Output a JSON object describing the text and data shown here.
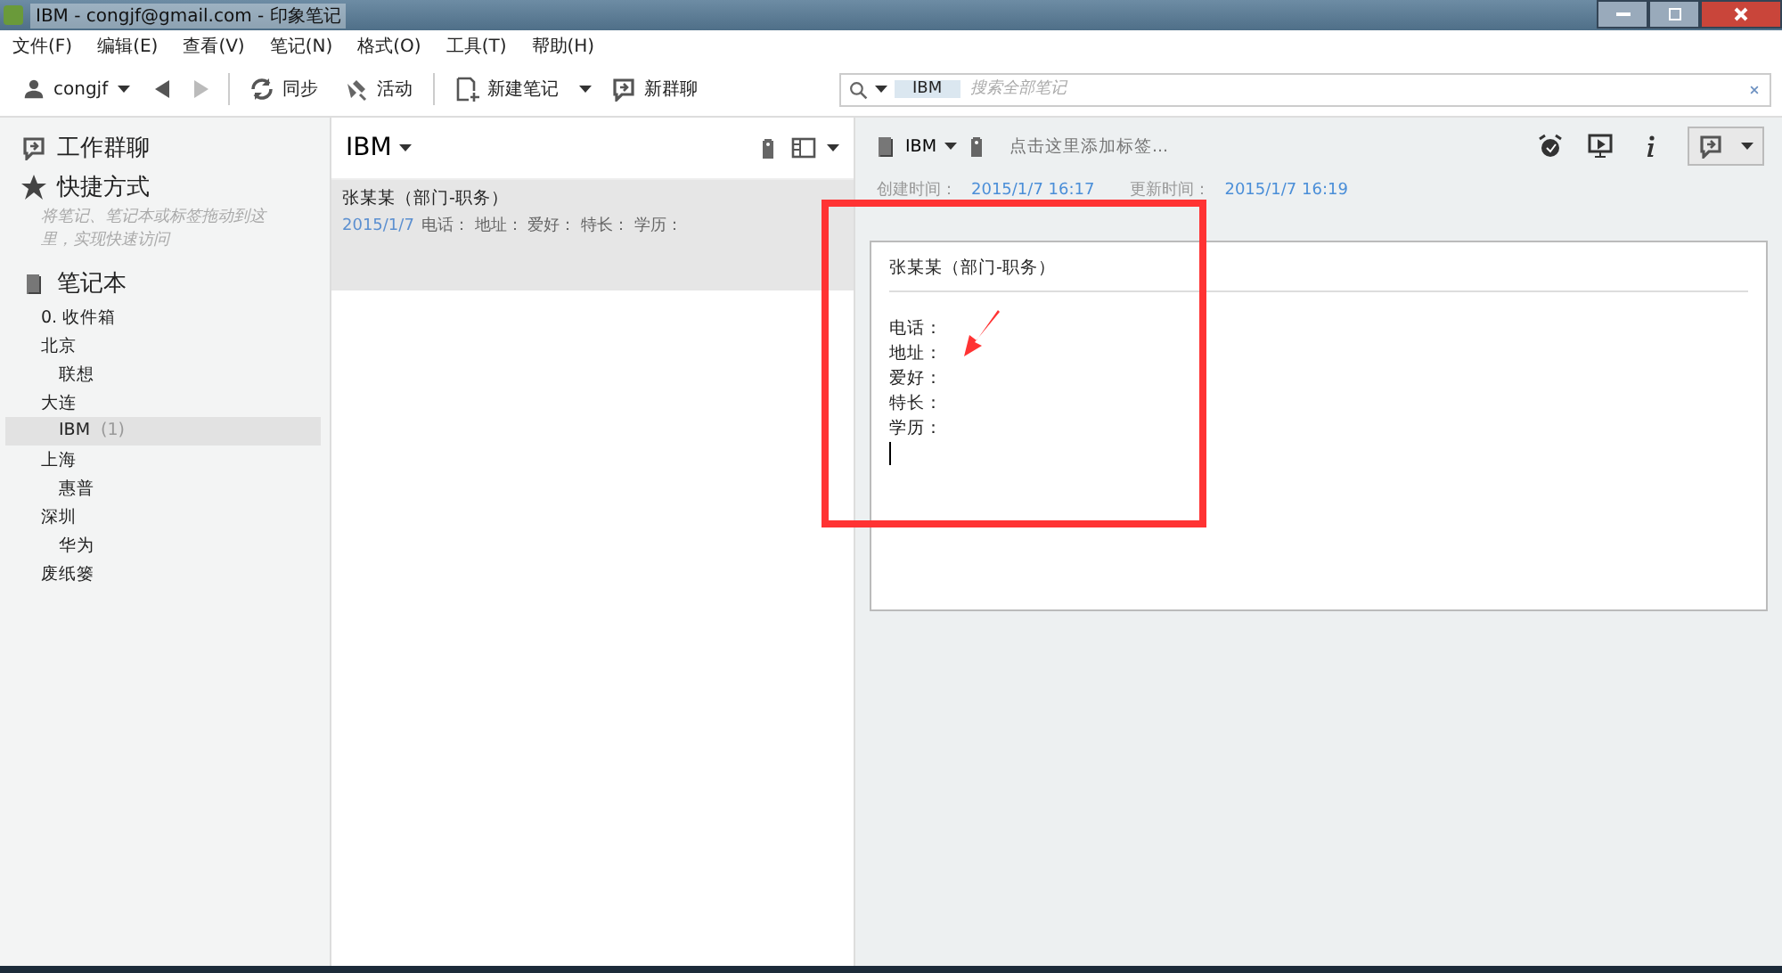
{
  "window": {
    "title": "IBM - congjf@gmail.com - 印象笔记"
  },
  "menu": [
    "文件(F)",
    "编辑(E)",
    "查看(V)",
    "笔记(N)",
    "格式(O)",
    "工具(T)",
    "帮助(H)"
  ],
  "toolbar": {
    "user": "congjf",
    "sync": "同步",
    "activity": "活动",
    "new_note": "新建笔记",
    "new_chat": "新群聊"
  },
  "search": {
    "scope": "IBM",
    "placeholder": "搜索全部笔记"
  },
  "sidebar": {
    "work_chat": "工作群聊",
    "shortcuts": "快捷方式",
    "shortcuts_hint": "将笔记、笔记本或标签拖动到这里，实现快速访问",
    "notebooks": "笔记本",
    "items": [
      {
        "label": "0. 收件箱",
        "selected": false
      },
      {
        "label": "北京",
        "selected": false,
        "children": [
          {
            "label": "联想",
            "selected": false
          }
        ]
      },
      {
        "label": "大连",
        "selected": false,
        "children": [
          {
            "label": "IBM",
            "count": "(1)",
            "selected": true
          }
        ]
      },
      {
        "label": "上海",
        "selected": false,
        "children": [
          {
            "label": "惠普",
            "selected": false
          }
        ]
      },
      {
        "label": "深圳",
        "selected": false,
        "children": [
          {
            "label": "华为",
            "selected": false
          }
        ]
      },
      {
        "label": "废纸篓",
        "selected": false
      }
    ]
  },
  "note_list": {
    "title": "IBM",
    "notes": [
      {
        "title": "张某某（部门-职务）",
        "date": "2015/1/7",
        "snippet": "电话： 地址： 爱好： 特长： 学历：",
        "selected": true
      }
    ]
  },
  "editor": {
    "notebook": "IBM",
    "tag_placeholder": "点击这里添加标签...",
    "created_label": "创建时间：",
    "created": "2015/1/7 16:17",
    "updated_label": "更新时间：",
    "updated": "2015/1/7 16:19",
    "title": "张某某（部门-职务）",
    "lines": [
      "电话：",
      "地址：",
      "爱好：",
      "特长：",
      "学历："
    ]
  }
}
